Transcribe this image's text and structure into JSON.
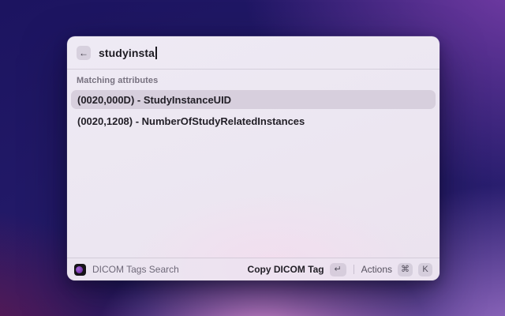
{
  "window": {
    "search": {
      "query": "studyinsta",
      "back_icon": "←"
    },
    "results": {
      "section_label": "Matching attributes",
      "items": [
        {
          "label": "(0020,000D) - StudyInstanceUID",
          "selected": true
        },
        {
          "label": "(0020,1208) - NumberOfStudyRelatedInstances",
          "selected": false
        }
      ]
    },
    "footer": {
      "app_name": "DICOM Tags Search",
      "primary_action_label": "Copy DICOM Tag",
      "primary_action_key": "↵",
      "actions_label": "Actions",
      "actions_key_1": "⌘",
      "actions_key_2": "K"
    }
  },
  "colors": {
    "selection_highlight": "#d7cfdd",
    "window_background": "#ece6f1",
    "wallpaper_indigo": "#1c1460",
    "wallpaper_purple": "#8041af",
    "wallpaper_pink": "#df92d8",
    "wallpaper_maroon": "#701848",
    "extension_icon_purple": "#7b3bb0"
  }
}
